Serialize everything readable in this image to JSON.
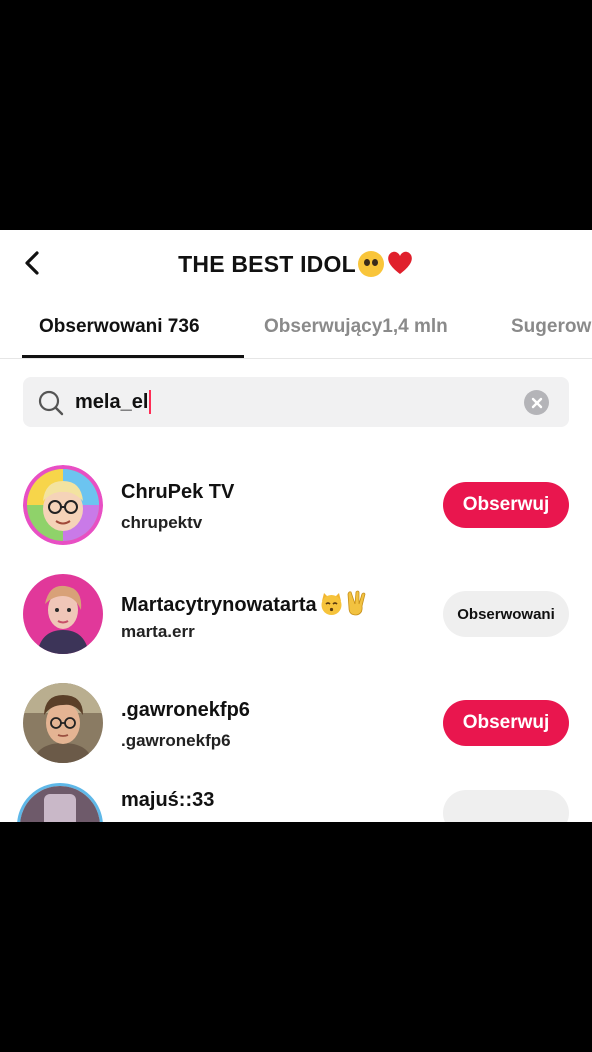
{
  "header": {
    "title": "THE BEST IDOL",
    "title_emoji": [
      "pleading-face-icon",
      "red-heart-icon"
    ]
  },
  "tabs": [
    {
      "label": "Obserwowani 736",
      "active": true
    },
    {
      "label": "Obserwujący1,4 mln",
      "active": false
    },
    {
      "label": "Sugerow",
      "active": false
    }
  ],
  "search": {
    "value": "mela_el"
  },
  "users": [
    {
      "name": "ChruPek TV",
      "handle": "chrupektv",
      "button": "Obserwuj",
      "state": "follow"
    },
    {
      "name": "Martacytrynowatarta",
      "name_emoji": [
        "kissing-cat-icon",
        "victory-hand-icon"
      ],
      "handle": "marta.err",
      "button": "Obserwowani",
      "state": "following"
    },
    {
      "name": ".gawronekfp6",
      "handle": ".gawronekfp6",
      "button": "Obserwuj",
      "state": "follow"
    },
    {
      "name": "majuś::33",
      "handle": "",
      "button": "",
      "state": "following"
    }
  ],
  "colors": {
    "accent": "#e9164e",
    "background": "#ffffff",
    "search_bg": "#f1f1f2",
    "following_bg": "#efefef",
    "letterbox": "#000000"
  }
}
